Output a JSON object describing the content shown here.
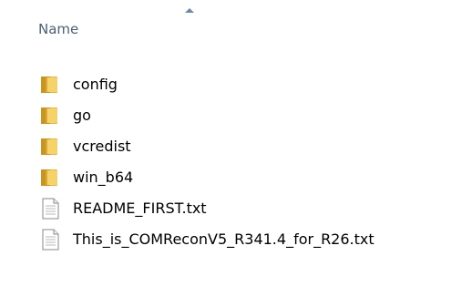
{
  "header": {
    "name_column": "Name"
  },
  "items": [
    {
      "name": "config",
      "kind": "folder"
    },
    {
      "name": "go",
      "kind": "folder"
    },
    {
      "name": "vcredist",
      "kind": "folder"
    },
    {
      "name": "win_b64",
      "kind": "folder"
    },
    {
      "name": "README_FIRST.txt",
      "kind": "text-file"
    },
    {
      "name": "This_is_COMReconV5_R341.4_for_R26.txt",
      "kind": "text-file"
    }
  ],
  "icons": {
    "folder": "folder-icon",
    "text-file": "text-file-icon"
  },
  "colors": {
    "header_text": "#4a5f7a",
    "folder_yellow": "#f2c94c",
    "folder_dark": "#b98a18"
  }
}
